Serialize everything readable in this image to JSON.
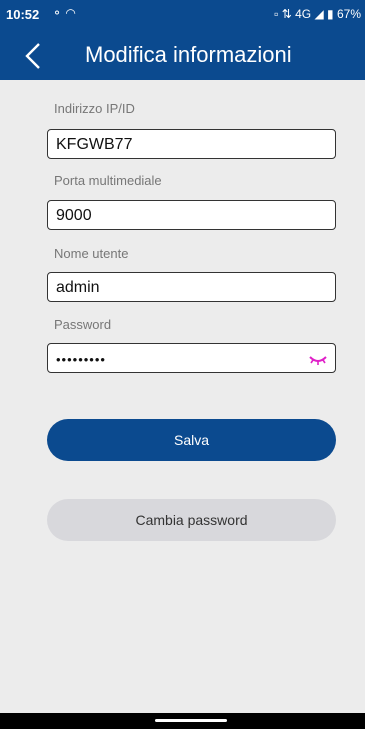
{
  "status_bar": {
    "time": "10:52",
    "left_icons": "⚬ ◠",
    "right_icons": "▫ ⇅ 4G ◢",
    "battery": "67%"
  },
  "header": {
    "title": "Modifica informazioni"
  },
  "form": {
    "ip_label": "Indirizzo IP/ID",
    "ip_value": "KFGWB77",
    "port_label": "Porta multimediale",
    "port_value": "9000",
    "user_label": "Nome utente",
    "user_value": "admin",
    "password_label": "Password",
    "password_value": "•••••••••"
  },
  "buttons": {
    "save_label": "Salva",
    "change_password_label": "Cambia password"
  },
  "colors": {
    "primary": "#0b4a8f",
    "eye_icon": "#e020c8"
  }
}
